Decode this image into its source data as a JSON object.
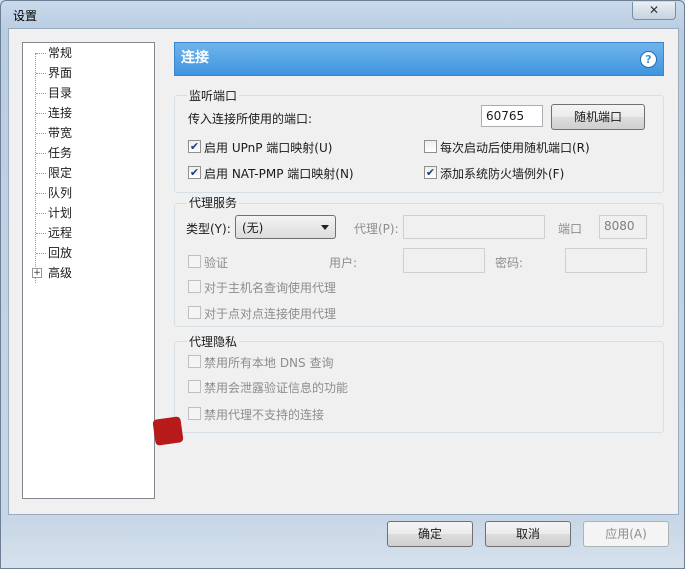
{
  "window": {
    "title": "设置",
    "close_symbol": "✕"
  },
  "sidebar": {
    "items": [
      {
        "label": "常规"
      },
      {
        "label": "界面"
      },
      {
        "label": "目录"
      },
      {
        "label": "连接"
      },
      {
        "label": "带宽"
      },
      {
        "label": "任务"
      },
      {
        "label": "限定"
      },
      {
        "label": "队列"
      },
      {
        "label": "计划"
      },
      {
        "label": "远程"
      },
      {
        "label": "回放"
      },
      {
        "label": "高级",
        "expander": "+"
      }
    ]
  },
  "page": {
    "title": "连接",
    "help_symbol": "?"
  },
  "listen": {
    "group_title": "监听端口",
    "port_label": "传入连接所使用的端口:",
    "port_value": "60765",
    "random_button": "随机端口",
    "upnp": {
      "label": "启用 UPnP 端口映射(U)",
      "checked": true
    },
    "random_each_start": {
      "label": "每次启动后使用随机端口(R)",
      "checked": false
    },
    "natpmp": {
      "label": "启用 NAT-PMP 端口映射(N)",
      "checked": true
    },
    "firewall": {
      "label": "添加系统防火墙例外(F)",
      "checked": true
    }
  },
  "proxy": {
    "group_title": "代理服务",
    "type_label": "类型(Y):",
    "type_value": "(无)",
    "proxy_label": "代理(P):",
    "proxy_value": "",
    "port_label": "端口",
    "port_value": "8080",
    "auth_label": "验证",
    "user_label": "用户:",
    "password_label": "密码:",
    "hostname_lookup_label": "对于主机名查询使用代理",
    "p2p_label": "对于点对点连接使用代理"
  },
  "privacy": {
    "group_title": "代理隐私",
    "disable_dns": "禁用所有本地 DNS 查询",
    "disable_leak": "禁用会泄露验证信息的功能",
    "disable_unsupported": "禁用代理不支持的连接"
  },
  "footer": {
    "ok": "确定",
    "cancel": "取消",
    "apply": "应用(A)"
  },
  "colors": {
    "header_blue": "#3f95de",
    "window_frame": "#c9d9ea",
    "disabled_text": "#8d8d8d"
  }
}
